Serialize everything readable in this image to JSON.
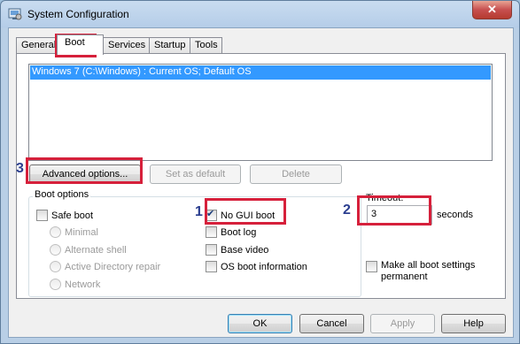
{
  "window": {
    "title": "System Configuration",
    "close_glyph": "✕"
  },
  "tabs": [
    {
      "label": "General"
    },
    {
      "label": "Boot"
    },
    {
      "label": "Services"
    },
    {
      "label": "Startup"
    },
    {
      "label": "Tools"
    }
  ],
  "boot_list": {
    "items": [
      "Windows 7 (C:\\Windows) : Current OS; Default OS"
    ]
  },
  "list_buttons": {
    "advanced": "Advanced options...",
    "set_default": "Set as default",
    "delete": "Delete"
  },
  "boot_options": {
    "group_label": "Boot options",
    "safe_boot": {
      "label": "Safe boot",
      "checked": false
    },
    "radios": [
      "Minimal",
      "Alternate shell",
      "Active Directory repair",
      "Network"
    ],
    "no_gui_boot": {
      "label": "No GUI boot",
      "checked": true
    },
    "boot_log": {
      "label": "Boot log",
      "checked": false
    },
    "base_video": {
      "label": "Base video",
      "checked": false
    },
    "os_boot_info": {
      "label": "OS boot information",
      "checked": false
    }
  },
  "timeout": {
    "label": "Timeout:",
    "value": "3",
    "unit": "seconds"
  },
  "permanent": {
    "label_line1": "Make all boot settings",
    "label_line2": "permanent",
    "checked": false
  },
  "footer": {
    "ok": "OK",
    "cancel": "Cancel",
    "apply": "Apply",
    "help": "Help"
  },
  "annotations": [
    "3",
    "1",
    "2"
  ],
  "colors": {
    "highlight": "#d6203b",
    "annotation_number": "#2b3e8f",
    "selection": "#3399ff"
  }
}
